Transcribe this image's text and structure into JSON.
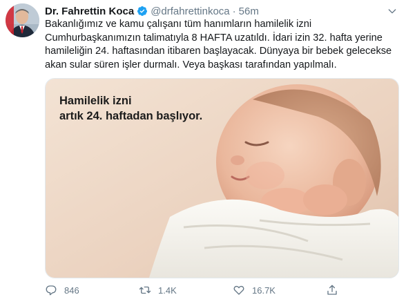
{
  "tweet": {
    "author_name": "Dr. Fahrettin Koca",
    "handle": "@drfahrettinkoca",
    "separator": "·",
    "time": "56m",
    "text_lines": [
      "Bakanlığımız ve kamu çalışanı tüm hanımların hamilelik izni",
      "Cumhurbaşkanımızın talimatıyla 8 HAFTA uzatıldı. İdari izin 32. hafta yerine",
      "hamileliğin 24. haftasından itibaren başlayacak. Dünyaya bir bebek gelecekse",
      "akan sular süren işler durmalı. Veya başkası tarafından yapılmalı."
    ],
    "media_caption_lines": [
      "Hamilelik izni",
      "artık 24. haftadan başlıyor."
    ],
    "actions": {
      "reply_count": "846",
      "retweet_count": "1.4K",
      "like_count": "16.7K"
    }
  },
  "colors": {
    "verified": "#1da1f2",
    "secondary_text": "#657786"
  },
  "icons": {
    "verified": "verified-badge-icon",
    "menu": "chevron-down-icon",
    "reply": "reply-icon",
    "retweet": "retweet-icon",
    "like": "heart-icon",
    "share": "share-icon"
  }
}
